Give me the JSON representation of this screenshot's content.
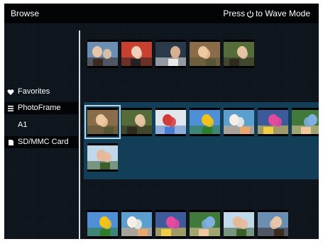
{
  "header": {
    "title": "Browse",
    "hint_prefix": "Press",
    "hint_suffix": "to Wave Mode"
  },
  "sidebar": {
    "items": [
      {
        "label": "Favorites",
        "icon": "heart-icon"
      },
      {
        "label": "PhotoFrame",
        "icon": "list-icon"
      },
      {
        "label": "A1",
        "icon": ""
      },
      {
        "label": "SD/MMC Card",
        "icon": "card-icon"
      }
    ],
    "selected": "PhotoFrame"
  },
  "albums": {
    "favorites": [
      {
        "scene": "two kids portrait"
      },
      {
        "scene": "child smiling"
      },
      {
        "scene": "family in doorway"
      },
      {
        "scene": "family group"
      },
      {
        "scene": "woman and girl"
      }
    ],
    "photoframe": [
      {
        "scene": "boy on beach",
        "selected": true
      },
      {
        "scene": "red flowers"
      },
      {
        "scene": "people with frame"
      },
      {
        "scene": "family collage"
      },
      {
        "scene": "photo collage"
      },
      {
        "scene": "sunflowers field"
      },
      {
        "scene": "child on beach"
      },
      {
        "scene": "flowering tree"
      }
    ],
    "sd_card": [
      {
        "scene": "colorful kite"
      },
      {
        "scene": "child in field"
      },
      {
        "scene": "girl with hat"
      },
      {
        "scene": "couple portrait"
      },
      {
        "scene": "family smiling"
      },
      {
        "scene": "woman with child"
      }
    ]
  },
  "colors": {
    "screen_bg": "#0b121a",
    "topbar_bg": "#020406",
    "selected_row_band": "#123f57",
    "divider": "#d9dde0",
    "selection_outline": "#b7d7e8"
  }
}
